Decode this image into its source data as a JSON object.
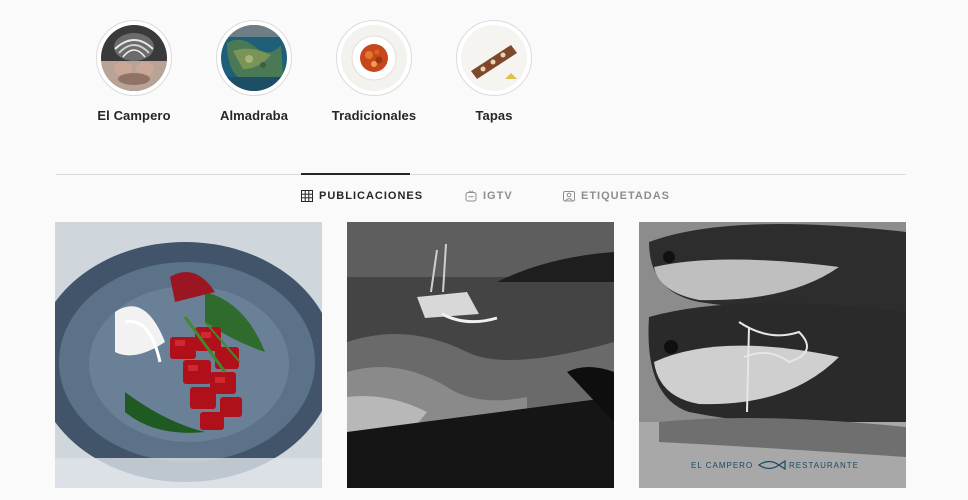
{
  "highlights": [
    {
      "label": "El Campero",
      "icon": "hands-photo"
    },
    {
      "label": "Almadraba",
      "icon": "nets-photo"
    },
    {
      "label": "Tradicionales",
      "icon": "stew-bowl-photo"
    },
    {
      "label": "Tapas",
      "icon": "tapa-plate-photo"
    }
  ],
  "tabs": [
    {
      "label": "PUBLICACIONES",
      "icon": "grid-icon",
      "active": true
    },
    {
      "label": "IGTV",
      "icon": "igtv-icon",
      "active": false
    },
    {
      "label": "ETIQUETADAS",
      "icon": "tagged-icon",
      "active": false
    }
  ],
  "posts": [
    {
      "subject": "tuna-tartare-bowl-photo"
    },
    {
      "subject": "fishing-boat-bw-photo"
    },
    {
      "subject": "bluefin-tuna-bw-photo",
      "watermark": "EL CAMPERO",
      "watermark_suffix": "RESTAURANTE"
    }
  ],
  "colors": {
    "accent": "#262626",
    "muted": "#8e8e8e",
    "border": "#dbdbdb",
    "background": "#fafafa"
  }
}
